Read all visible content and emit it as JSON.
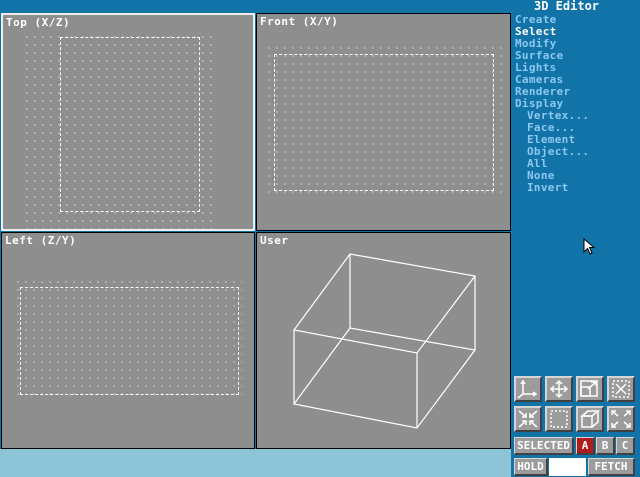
{
  "app": {
    "title": "3D Editor"
  },
  "viewports": {
    "top": {
      "label": "Top (X/Z)"
    },
    "front": {
      "label": "Front (X/Y)"
    },
    "left": {
      "label": "Left (Z/Y)"
    },
    "user": {
      "label": "User"
    }
  },
  "menu": {
    "items": [
      "Create",
      "Select",
      "Modify",
      "Surface",
      "Lights",
      "Cameras",
      "Renderer",
      "Display"
    ],
    "selected": "Select",
    "submenu": [
      "Vertex...",
      "Face...",
      "Element",
      "Object...",
      "All",
      "None",
      "Invert"
    ]
  },
  "toolbar": {
    "icons": [
      "axis-icon",
      "move-icon",
      "scale-icon",
      "clear-selection-icon",
      "shrink-icon",
      "region-select-icon",
      "box-icon",
      "expand-icon"
    ]
  },
  "selection": {
    "selected_label": "SELECTED",
    "set_a": "A",
    "set_b": "B",
    "set_c": "C",
    "active_set": "A"
  },
  "buffer": {
    "hold_label": "HOLD",
    "fetch_label": "FETCH"
  },
  "colors": {
    "background": "#1273a8",
    "viewport": "#8e8e8e",
    "menu_text": "#8cc8f0",
    "selected_text": "#ffffff",
    "active_set": "#b01c1c",
    "status_bar": "#8ec4d8"
  }
}
